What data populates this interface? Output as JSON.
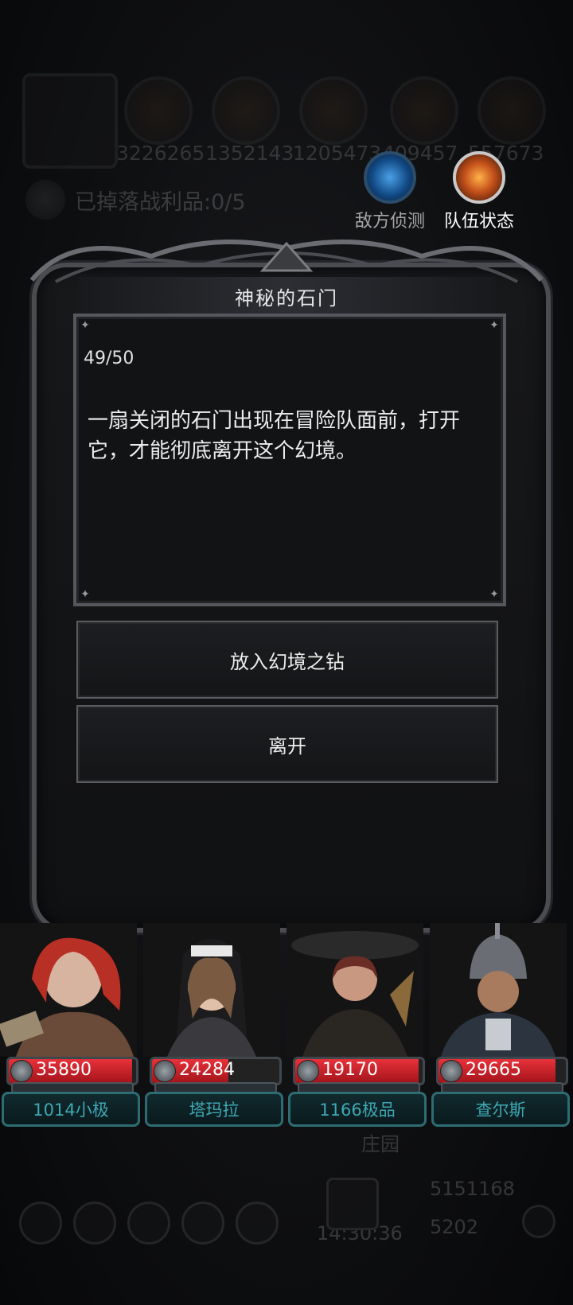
{
  "hud": {
    "numbers": [
      "3226265",
      "1352143",
      "1205473",
      "409457",
      "557673"
    ],
    "loot": "已掉落战利品:0/5",
    "scout_label": "敌方侦测",
    "team_label": "队伍状态",
    "estate_label": "庄园",
    "gold": "5151168",
    "gems": "5202",
    "timer": "14:30:36"
  },
  "event": {
    "title": "神秘的石门",
    "counter": "49/50",
    "story": "一扇关闭的石门出现在冒险队面前，打开它，才能彻底离开这个幻境。",
    "choices": [
      "放入幻境之钻",
      "离开"
    ]
  },
  "party": [
    {
      "name": "1014小极",
      "hp": "35890",
      "hp_fraction": 0.97,
      "color": "#b04032"
    },
    {
      "name": "塔玛拉",
      "hp": "24284",
      "hp_fraction": 0.6,
      "color": "#5a5147"
    },
    {
      "name": "1166极品",
      "hp": "19170",
      "hp_fraction": 0.97,
      "color": "#5a3c2e"
    },
    {
      "name": "查尔斯",
      "hp": "29665",
      "hp_fraction": 0.92,
      "color": "#3a4450"
    }
  ]
}
